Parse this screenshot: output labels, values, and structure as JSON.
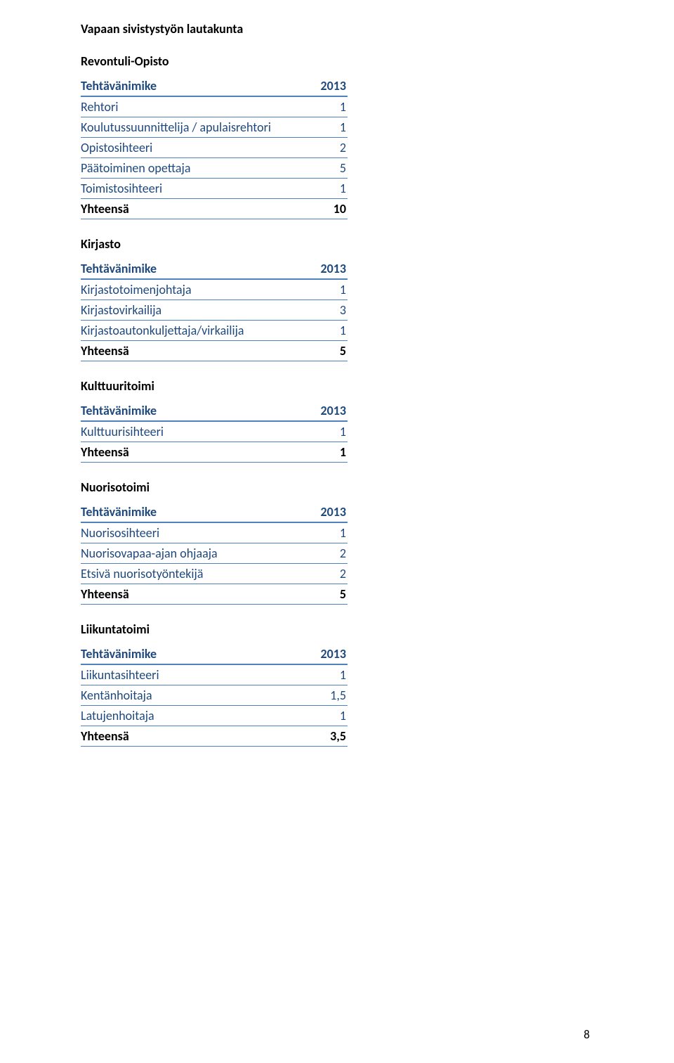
{
  "pageTitle": "Vapaan sivistystyön lautakunta",
  "headerLabel": "Tehtävänimike",
  "headerYear": "2013",
  "totalLabel": "Yhteensä",
  "pageNumber": "8",
  "sections": [
    {
      "title": "Revontuli-Opisto",
      "rows": [
        {
          "label": "Rehtori",
          "value": "1"
        },
        {
          "label": "Koulutussuunnittelija / apulaisrehtori",
          "value": "1"
        },
        {
          "label": "Opistosihteeri",
          "value": "2"
        },
        {
          "label": "Päätoiminen opettaja",
          "value": "5"
        },
        {
          "label": "Toimistosihteeri",
          "value": "1"
        }
      ],
      "total": "10"
    },
    {
      "title": "Kirjasto",
      "rows": [
        {
          "label": "Kirjastotoimenjohtaja",
          "value": "1"
        },
        {
          "label": "Kirjastovirkailija",
          "value": "3"
        },
        {
          "label": "Kirjastoautonkuljettaja/virkailija",
          "value": "1"
        }
      ],
      "total": "5"
    },
    {
      "title": "Kulttuuritoimi",
      "rows": [
        {
          "label": "Kulttuurisihteeri",
          "value": "1"
        }
      ],
      "total": "1"
    },
    {
      "title": "Nuorisotoimi",
      "rows": [
        {
          "label": "Nuorisosihteeri",
          "value": "1"
        },
        {
          "label": "Nuorisovapaa-ajan ohjaaja",
          "value": "2"
        },
        {
          "label": "Etsivä nuorisotyöntekijä",
          "value": "2"
        }
      ],
      "total": "5"
    },
    {
      "title": "Liikuntatoimi",
      "rows": [
        {
          "label": "Liikuntasihteeri",
          "value": "1"
        },
        {
          "label": "Kentänhoitaja",
          "value": "1,5"
        },
        {
          "label": "Latujenhoitaja",
          "value": "1"
        }
      ],
      "total": "3,5"
    }
  ]
}
